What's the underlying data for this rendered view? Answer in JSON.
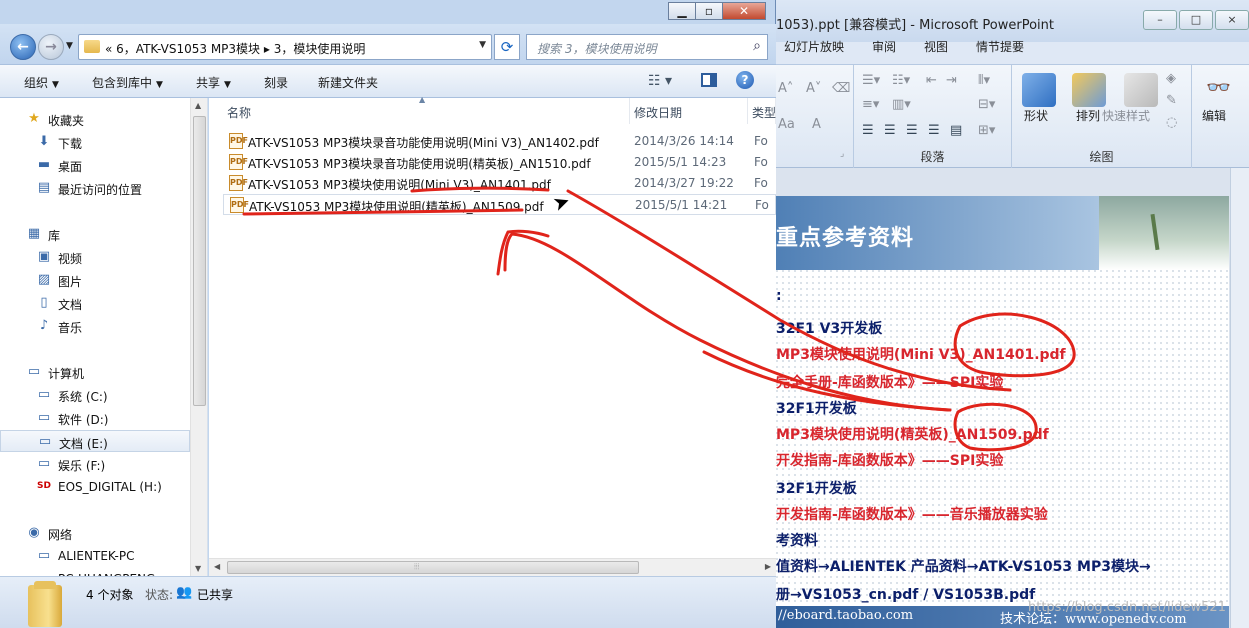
{
  "ppt": {
    "title": "1053).ppt [兼容模式]  -  Microsoft PowerPoint",
    "tabs": [
      "幻灯片放映",
      "审阅",
      "视图",
      "情节提要"
    ],
    "ribbon": {
      "groups": [
        "段落",
        "绘图"
      ],
      "buttons": [
        "形状",
        "排列",
        "快速样式",
        "编辑"
      ]
    },
    "slide": {
      "title": "重点参考资料",
      "lines": [
        {
          "text": ":",
          "color": "navy"
        },
        {
          "text": "32F1 V3开发板",
          "color": "navy"
        },
        {
          "text": "MP3模块使用说明(Mini V3)_AN1401.pdf",
          "color": "red"
        },
        {
          "text": "完全手册-库函数版本》——SPI实验",
          "color": "red"
        },
        {
          "text": "32F1开发板",
          "color": "navy"
        },
        {
          "text": "MP3模块使用说明(精英板)_AN1509.pdf",
          "color": "red"
        },
        {
          "text": "开发指南-库函数版本》——SPI实验",
          "color": "red"
        },
        {
          "text": "32F1开发板",
          "color": "navy"
        },
        {
          "text": "开发指南-库函数版本》——音乐播放器实验",
          "color": "red"
        },
        {
          "text": "考资料",
          "color": "navy"
        },
        {
          "text": "值资料→ALIENTEK 产品资料→ATK-VS1053 MP3模块→",
          "color": "navy"
        },
        {
          "text": "册→VS1053_cn.pdf  /  VS1053B.pdf",
          "color": "navy"
        }
      ],
      "footer_left": "//eboard.taobao.com",
      "footer_right": "技术论坛：www.openedv.com"
    }
  },
  "explorer": {
    "address": {
      "path": "«  6，ATK-VS1053 MP3模块  ▸  3，模块使用说明",
      "search_placeholder": "搜索 3，模块使用说明"
    },
    "toolbar": [
      "组织",
      "包含到库中",
      "共享",
      "刻录",
      "新建文件夹"
    ],
    "nav": [
      {
        "label": "收藏夹",
        "icon": "★",
        "indent": 1,
        "sel": false
      },
      {
        "label": "下载",
        "icon": "⬇",
        "indent": 2,
        "sel": false
      },
      {
        "label": "桌面",
        "icon": "▬",
        "indent": 2,
        "sel": false
      },
      {
        "label": "最近访问的位置",
        "icon": "▤",
        "indent": 2,
        "sel": false
      },
      {
        "label": "库",
        "icon": "▦",
        "indent": 1,
        "sel": false
      },
      {
        "label": "视频",
        "icon": "▣",
        "indent": 2,
        "sel": false
      },
      {
        "label": "图片",
        "icon": "▨",
        "indent": 2,
        "sel": false
      },
      {
        "label": "文档",
        "icon": "▯",
        "indent": 2,
        "sel": false
      },
      {
        "label": "音乐",
        "icon": "♪",
        "indent": 2,
        "sel": false
      },
      {
        "label": "计算机",
        "icon": "▭",
        "indent": 1,
        "sel": false
      },
      {
        "label": "系统 (C:)",
        "icon": "▭",
        "indent": 2,
        "sel": false
      },
      {
        "label": "软件 (D:)",
        "icon": "▭",
        "indent": 2,
        "sel": false
      },
      {
        "label": "文档 (E:)",
        "icon": "▭",
        "indent": 2,
        "sel": true
      },
      {
        "label": "娱乐 (F:)",
        "icon": "▭",
        "indent": 2,
        "sel": false
      },
      {
        "label": "EOS_DIGITAL (H:)",
        "icon": "SD",
        "indent": 2,
        "sel": false
      },
      {
        "label": "网络",
        "icon": "◉",
        "indent": 1,
        "sel": false
      },
      {
        "label": "ALIENTEK-PC",
        "icon": "▭",
        "indent": 2,
        "sel": false
      },
      {
        "label": "PC-HUANGPENG",
        "icon": "▭",
        "indent": 2,
        "sel": false
      }
    ],
    "columns": [
      "名称",
      "修改日期",
      "类型"
    ],
    "files": [
      {
        "name": "ATK-VS1053 MP3模块录音功能使用说明(Mini V3)_AN1402.pdf",
        "date": "2014/3/26 14:14",
        "type": "Fo"
      },
      {
        "name": "ATK-VS1053 MP3模块录音功能使用说明(精英板)_AN1510.pdf",
        "date": "2015/5/1 14:23",
        "type": "Fo"
      },
      {
        "name": "ATK-VS1053 MP3模块使用说明(Mini V3)_AN1401.pdf",
        "date": "2014/3/27 19:22",
        "type": "Fo"
      },
      {
        "name": "ATK-VS1053 MP3模块使用说明(精英板)_AN1509.pdf",
        "date": "2015/5/1 14:21",
        "type": "Fo"
      }
    ],
    "status": {
      "count": "4 个对象",
      "state_label": "状态:",
      "state_value": "已共享"
    }
  },
  "watermark": "https://blog.csdn.net/lidew521",
  "colors": {
    "annotation": "#e0241b",
    "accent": "#2a64b4"
  }
}
